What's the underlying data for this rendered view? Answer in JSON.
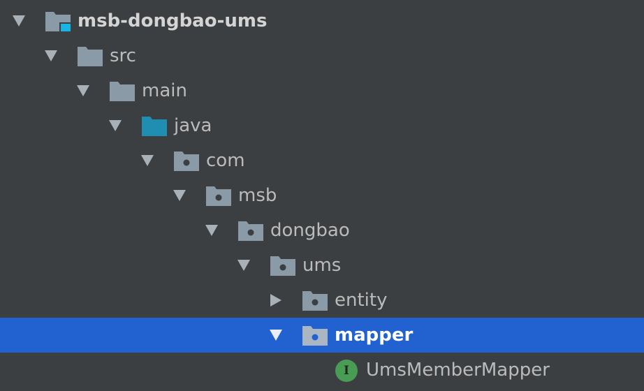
{
  "tree": {
    "selected_color": "#2161d0",
    "items": [
      {
        "label": "msb-dongbao-ums",
        "icon": "module-folder-icon",
        "expanded": true
      },
      {
        "label": "src",
        "icon": "folder-icon",
        "expanded": true
      },
      {
        "label": "main",
        "icon": "folder-icon",
        "expanded": true
      },
      {
        "label": "java",
        "icon": "source-root-folder-icon",
        "expanded": true
      },
      {
        "label": "com",
        "icon": "package-icon",
        "expanded": true
      },
      {
        "label": "msb",
        "icon": "package-icon",
        "expanded": true
      },
      {
        "label": "dongbao",
        "icon": "package-icon",
        "expanded": true
      },
      {
        "label": "ums",
        "icon": "package-icon",
        "expanded": true
      },
      {
        "label": "entity",
        "icon": "package-icon",
        "expanded": false
      },
      {
        "label": "mapper",
        "icon": "package-icon",
        "expanded": true,
        "selected": true
      },
      {
        "label": "UmsMemberMapper",
        "icon": "interface-icon",
        "icon_letter": "I"
      }
    ]
  }
}
